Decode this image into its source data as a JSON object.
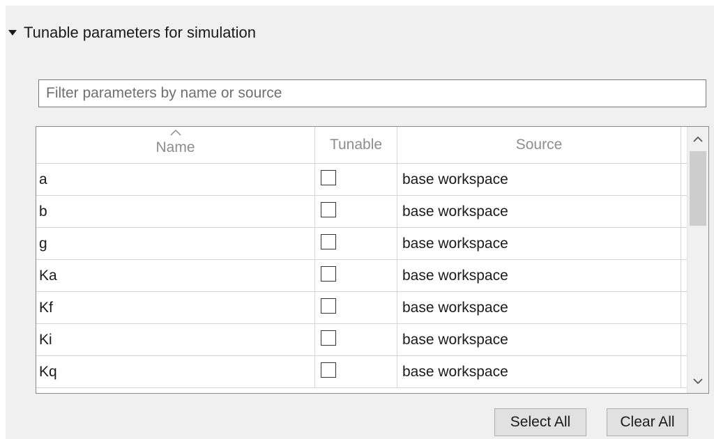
{
  "section": {
    "title": "Tunable parameters for simulation",
    "expanded": true
  },
  "filter": {
    "placeholder": "Filter parameters by name or source",
    "value": ""
  },
  "table": {
    "columns": [
      "Name",
      "Tunable",
      "Source"
    ],
    "sorted_column": "Name",
    "rows": [
      {
        "name": "a",
        "tunable": false,
        "source": "base workspace"
      },
      {
        "name": "b",
        "tunable": false,
        "source": "base workspace"
      },
      {
        "name": "g",
        "tunable": false,
        "source": "base workspace"
      },
      {
        "name": "Ka",
        "tunable": false,
        "source": "base workspace"
      },
      {
        "name": "Kf",
        "tunable": false,
        "source": "base workspace"
      },
      {
        "name": "Ki",
        "tunable": false,
        "source": "base workspace"
      },
      {
        "name": "Kq",
        "tunable": false,
        "source": "base workspace"
      }
    ]
  },
  "buttons": {
    "select_all": "Select All",
    "clear_all": "Clear All"
  },
  "icons": {
    "section_toggle": "expand-triangle-icon",
    "sort": "sort-ascending-icon",
    "scroll_up": "chevron-up-icon",
    "scroll_down": "chevron-down-icon"
  },
  "colors": {
    "panel_background": "#f0f0f0",
    "header_text": "#8d8d8d",
    "grid_lines": "#d4d4d4",
    "button_background": "#e1e1e1"
  }
}
